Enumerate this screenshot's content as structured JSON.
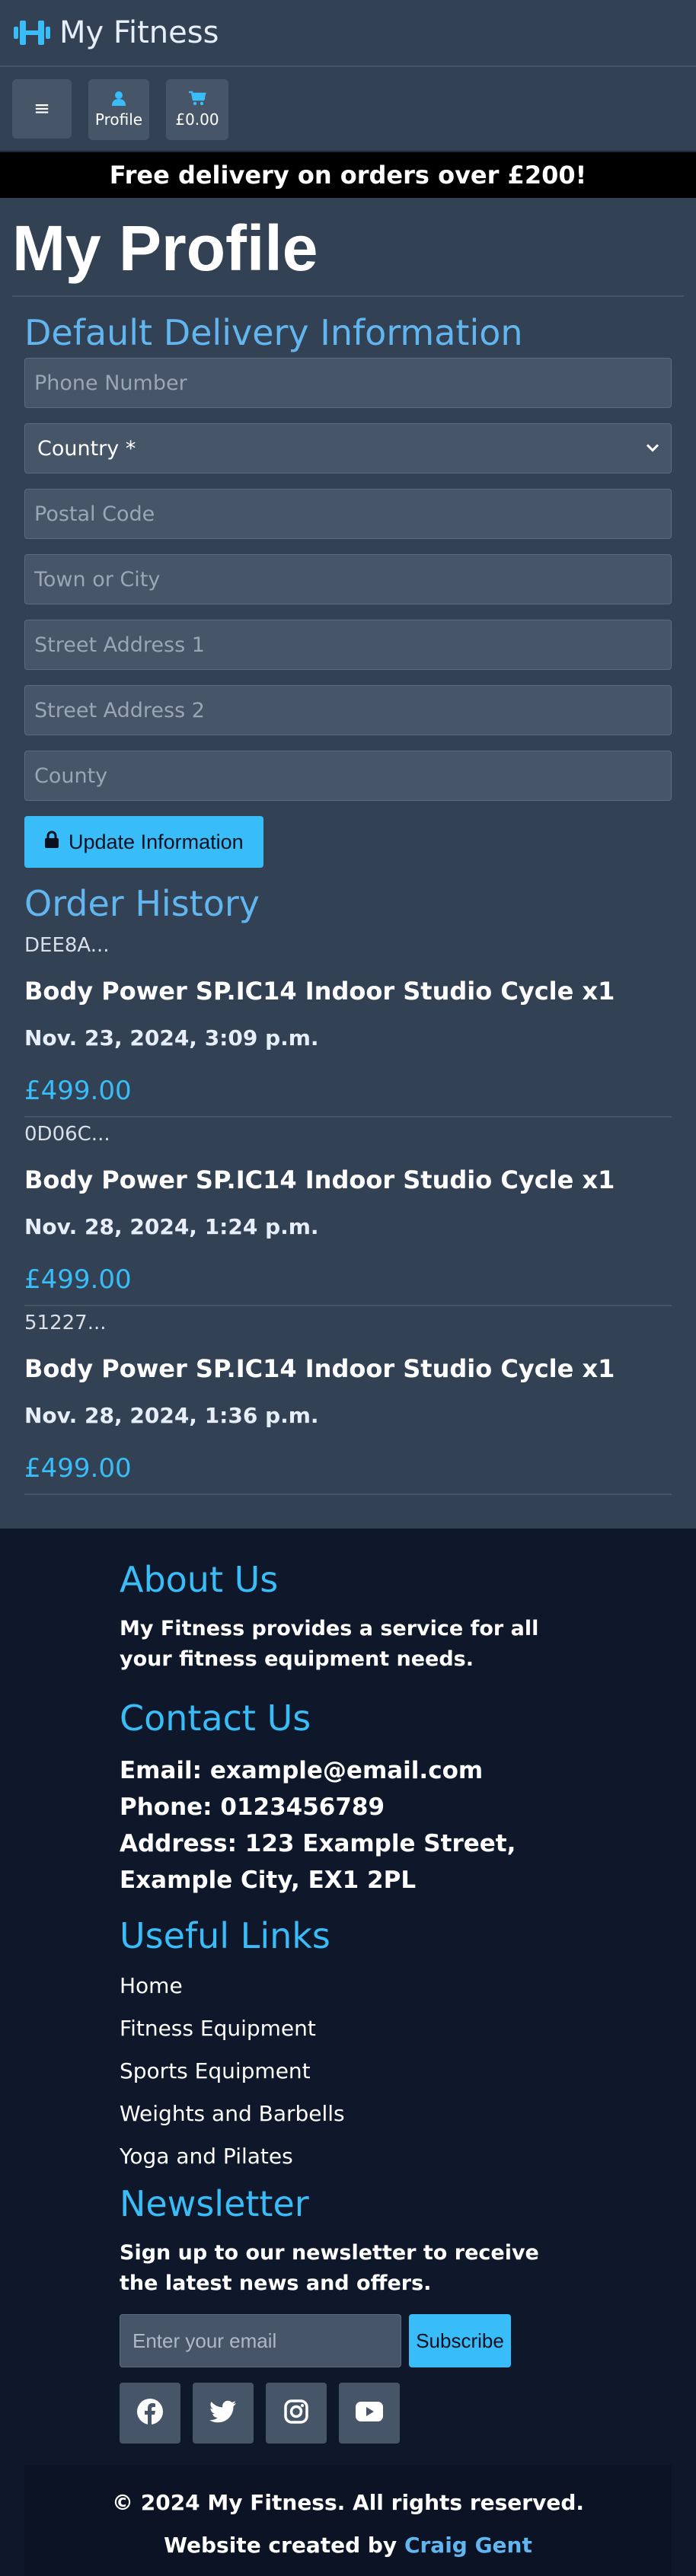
{
  "header": {
    "brand": "My Fitness"
  },
  "toolbar": {
    "menu_label": "≡",
    "profile_label": "Profile",
    "cart_total": "£0.00"
  },
  "banner": {
    "text": "Free delivery on orders over £200!"
  },
  "profile": {
    "title": "My Profile",
    "delivery": {
      "heading": "Default Delivery Information",
      "phone_placeholder": "Phone Number",
      "country_selected": "Country *",
      "postal_placeholder": "Postal Code",
      "town_placeholder": "Town or City",
      "street1_placeholder": "Street Address 1",
      "street2_placeholder": "Street Address 2",
      "county_placeholder": "County",
      "update_label": "Update Information"
    },
    "orders": {
      "heading": "Order History",
      "items": [
        {
          "number": "DEE8A...",
          "item": "Body Power SP.IC14 Indoor Studio Cycle x1",
          "date": "Nov. 23, 2024, 3:09 p.m.",
          "total": "£499.00"
        },
        {
          "number": "0D06C...",
          "item": "Body Power SP.IC14 Indoor Studio Cycle x1",
          "date": "Nov. 28, 2024, 1:24 p.m.",
          "total": "£499.00"
        },
        {
          "number": "51227...",
          "item": "Body Power SP.IC14 Indoor Studio Cycle x1",
          "date": "Nov. 28, 2024, 1:36 p.m.",
          "total": "£499.00"
        }
      ]
    }
  },
  "footer": {
    "about_heading": "About Us",
    "about_text": "My Fitness provides a service for all your fitness equipment needs.",
    "contact_heading": "Contact Us",
    "email": "Email: example@email.com",
    "phone": "Phone: 0123456789",
    "address": "Address: 123 Example Street, Example City, EX1 2PL",
    "links_heading": "Useful Links",
    "links": [
      "Home",
      "Fitness Equipment",
      "Sports Equipment",
      "Weights and Barbells",
      "Yoga and Pilates"
    ],
    "newsletter_heading": "Newsletter",
    "newsletter_text": "Sign up to our newsletter to receive the latest news and offers.",
    "email_placeholder": "Enter your email",
    "subscribe_label": "Subscribe",
    "socials": [
      "facebook-icon",
      "twitter-icon",
      "instagram-icon",
      "youtube-icon"
    ],
    "copyright": "© 2024 My Fitness. All rights reserved.",
    "credit_prefix": "Website created by ",
    "credit_name": "Craig Gent"
  },
  "colors": {
    "accent": "#38bdf8",
    "heading_blue": "#62b6f0",
    "panel": "#334155",
    "footer_bg": "#0f172a"
  }
}
